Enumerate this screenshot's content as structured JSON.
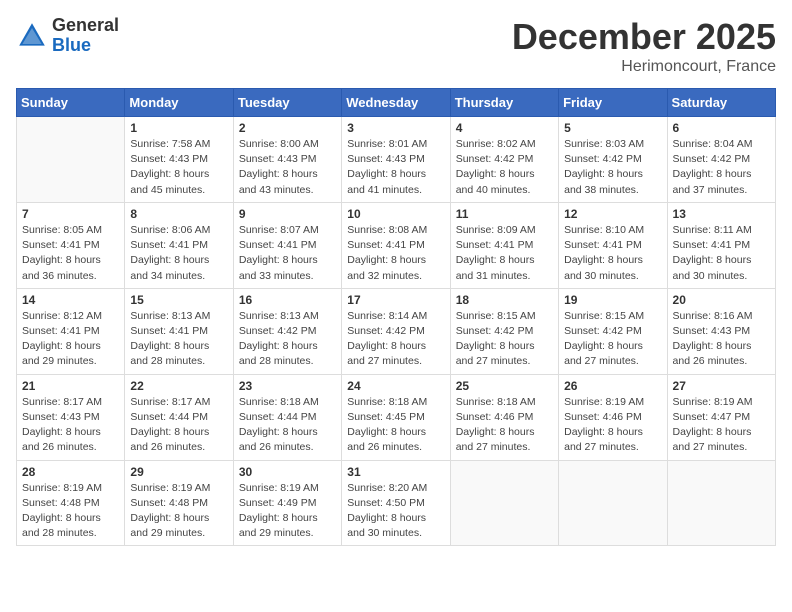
{
  "header": {
    "logo_line1": "General",
    "logo_line2": "Blue",
    "month_title": "December 2025",
    "location": "Herimoncourt, France"
  },
  "days_of_week": [
    "Sunday",
    "Monday",
    "Tuesday",
    "Wednesday",
    "Thursday",
    "Friday",
    "Saturday"
  ],
  "weeks": [
    [
      {
        "day": "",
        "info": ""
      },
      {
        "day": "1",
        "info": "Sunrise: 7:58 AM\nSunset: 4:43 PM\nDaylight: 8 hours\nand 45 minutes."
      },
      {
        "day": "2",
        "info": "Sunrise: 8:00 AM\nSunset: 4:43 PM\nDaylight: 8 hours\nand 43 minutes."
      },
      {
        "day": "3",
        "info": "Sunrise: 8:01 AM\nSunset: 4:43 PM\nDaylight: 8 hours\nand 41 minutes."
      },
      {
        "day": "4",
        "info": "Sunrise: 8:02 AM\nSunset: 4:42 PM\nDaylight: 8 hours\nand 40 minutes."
      },
      {
        "day": "5",
        "info": "Sunrise: 8:03 AM\nSunset: 4:42 PM\nDaylight: 8 hours\nand 38 minutes."
      },
      {
        "day": "6",
        "info": "Sunrise: 8:04 AM\nSunset: 4:42 PM\nDaylight: 8 hours\nand 37 minutes."
      }
    ],
    [
      {
        "day": "7",
        "info": "Sunrise: 8:05 AM\nSunset: 4:41 PM\nDaylight: 8 hours\nand 36 minutes."
      },
      {
        "day": "8",
        "info": "Sunrise: 8:06 AM\nSunset: 4:41 PM\nDaylight: 8 hours\nand 34 minutes."
      },
      {
        "day": "9",
        "info": "Sunrise: 8:07 AM\nSunset: 4:41 PM\nDaylight: 8 hours\nand 33 minutes."
      },
      {
        "day": "10",
        "info": "Sunrise: 8:08 AM\nSunset: 4:41 PM\nDaylight: 8 hours\nand 32 minutes."
      },
      {
        "day": "11",
        "info": "Sunrise: 8:09 AM\nSunset: 4:41 PM\nDaylight: 8 hours\nand 31 minutes."
      },
      {
        "day": "12",
        "info": "Sunrise: 8:10 AM\nSunset: 4:41 PM\nDaylight: 8 hours\nand 30 minutes."
      },
      {
        "day": "13",
        "info": "Sunrise: 8:11 AM\nSunset: 4:41 PM\nDaylight: 8 hours\nand 30 minutes."
      }
    ],
    [
      {
        "day": "14",
        "info": "Sunrise: 8:12 AM\nSunset: 4:41 PM\nDaylight: 8 hours\nand 29 minutes."
      },
      {
        "day": "15",
        "info": "Sunrise: 8:13 AM\nSunset: 4:41 PM\nDaylight: 8 hours\nand 28 minutes."
      },
      {
        "day": "16",
        "info": "Sunrise: 8:13 AM\nSunset: 4:42 PM\nDaylight: 8 hours\nand 28 minutes."
      },
      {
        "day": "17",
        "info": "Sunrise: 8:14 AM\nSunset: 4:42 PM\nDaylight: 8 hours\nand 27 minutes."
      },
      {
        "day": "18",
        "info": "Sunrise: 8:15 AM\nSunset: 4:42 PM\nDaylight: 8 hours\nand 27 minutes."
      },
      {
        "day": "19",
        "info": "Sunrise: 8:15 AM\nSunset: 4:42 PM\nDaylight: 8 hours\nand 27 minutes."
      },
      {
        "day": "20",
        "info": "Sunrise: 8:16 AM\nSunset: 4:43 PM\nDaylight: 8 hours\nand 26 minutes."
      }
    ],
    [
      {
        "day": "21",
        "info": "Sunrise: 8:17 AM\nSunset: 4:43 PM\nDaylight: 8 hours\nand 26 minutes."
      },
      {
        "day": "22",
        "info": "Sunrise: 8:17 AM\nSunset: 4:44 PM\nDaylight: 8 hours\nand 26 minutes."
      },
      {
        "day": "23",
        "info": "Sunrise: 8:18 AM\nSunset: 4:44 PM\nDaylight: 8 hours\nand 26 minutes."
      },
      {
        "day": "24",
        "info": "Sunrise: 8:18 AM\nSunset: 4:45 PM\nDaylight: 8 hours\nand 26 minutes."
      },
      {
        "day": "25",
        "info": "Sunrise: 8:18 AM\nSunset: 4:46 PM\nDaylight: 8 hours\nand 27 minutes."
      },
      {
        "day": "26",
        "info": "Sunrise: 8:19 AM\nSunset: 4:46 PM\nDaylight: 8 hours\nand 27 minutes."
      },
      {
        "day": "27",
        "info": "Sunrise: 8:19 AM\nSunset: 4:47 PM\nDaylight: 8 hours\nand 27 minutes."
      }
    ],
    [
      {
        "day": "28",
        "info": "Sunrise: 8:19 AM\nSunset: 4:48 PM\nDaylight: 8 hours\nand 28 minutes."
      },
      {
        "day": "29",
        "info": "Sunrise: 8:19 AM\nSunset: 4:48 PM\nDaylight: 8 hours\nand 29 minutes."
      },
      {
        "day": "30",
        "info": "Sunrise: 8:19 AM\nSunset: 4:49 PM\nDaylight: 8 hours\nand 29 minutes."
      },
      {
        "day": "31",
        "info": "Sunrise: 8:20 AM\nSunset: 4:50 PM\nDaylight: 8 hours\nand 30 minutes."
      },
      {
        "day": "",
        "info": ""
      },
      {
        "day": "",
        "info": ""
      },
      {
        "day": "",
        "info": ""
      }
    ]
  ]
}
